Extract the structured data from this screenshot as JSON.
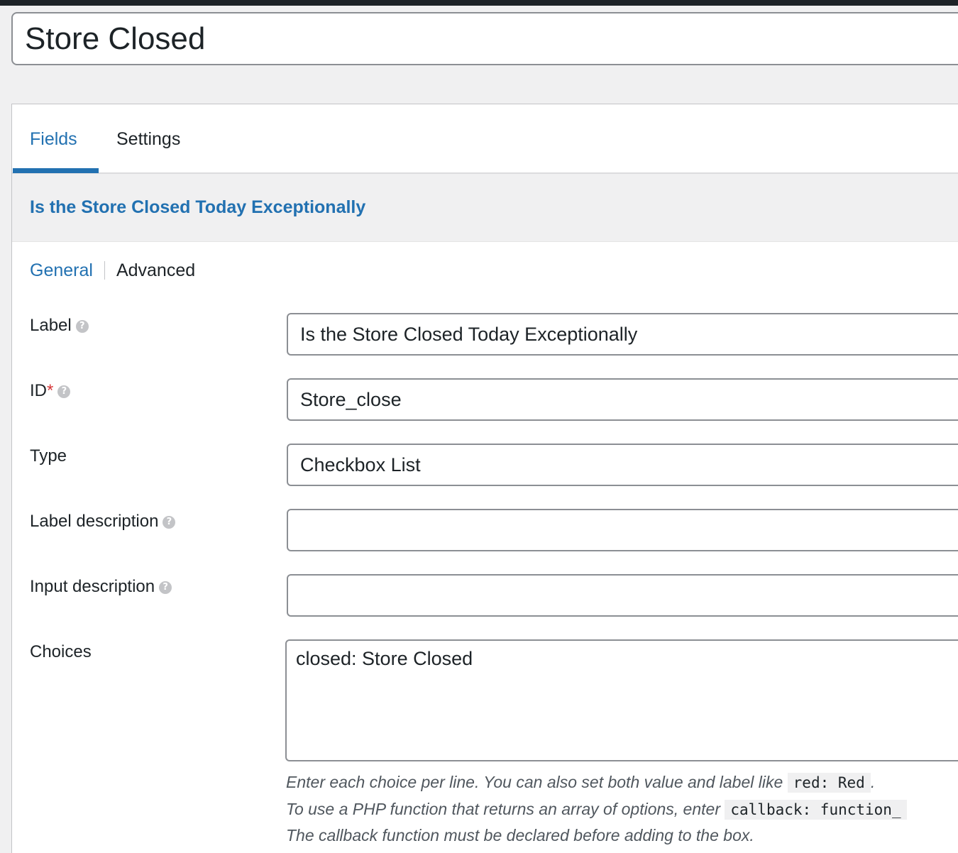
{
  "post_title": "Store Closed",
  "tabs": [
    {
      "label": "Fields",
      "active": true
    },
    {
      "label": "Settings",
      "active": false
    }
  ],
  "field": {
    "header_title": "Is the Store Closed Today Exceptionally",
    "subtabs": [
      {
        "label": "General",
        "active": true
      },
      {
        "label": "Advanced",
        "active": false
      }
    ],
    "rows": {
      "label": {
        "label": "Label",
        "help_icon": "question-icon",
        "value": "Is the Store Closed Today Exceptionally"
      },
      "id": {
        "label": "ID",
        "required_mark": "*",
        "help_icon": "question-icon",
        "value": "Store_close"
      },
      "type": {
        "label": "Type",
        "value": "Checkbox List"
      },
      "label_description": {
        "label": "Label description",
        "help_icon": "question-icon",
        "value": ""
      },
      "input_description": {
        "label": "Input description",
        "help_icon": "question-icon",
        "value": ""
      },
      "choices": {
        "label": "Choices",
        "value": "closed: Store Closed"
      }
    },
    "choices_help": {
      "line1_text": "Enter each choice per line. You can also set both value and label like",
      "line1_code": "red: Red",
      "line1_end": ".",
      "line2_text": "To use a PHP function that returns an array of options, enter",
      "line2_code": "callback: function_",
      "line3_text": "The callback function must be declared before adding to the box."
    }
  },
  "colors": {
    "accent": "#2271b1",
    "required": "#d63638",
    "background": "#f0f0f1"
  }
}
